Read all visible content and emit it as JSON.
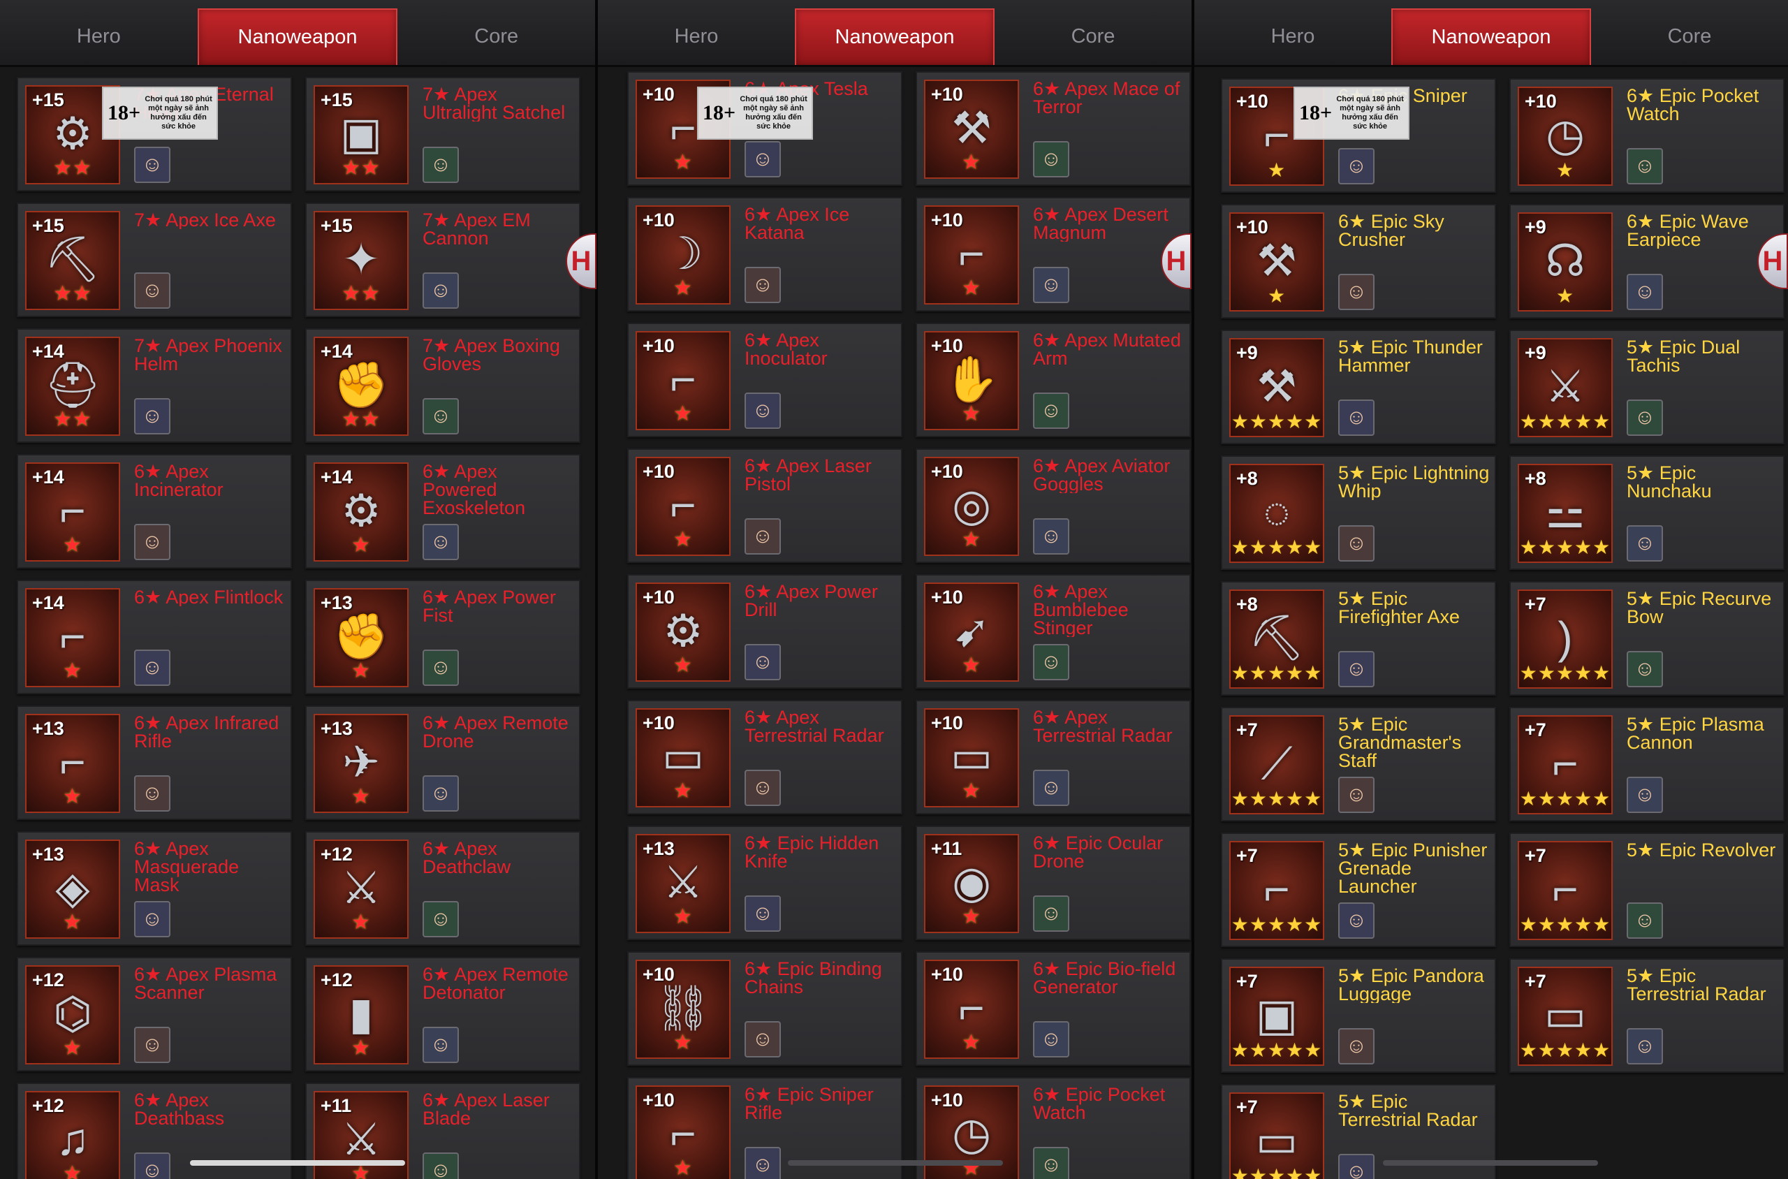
{
  "panels": [
    {
      "tabs": [
        {
          "label": "Hero",
          "active": false
        },
        {
          "label": "Nanoweapon",
          "active": true
        },
        {
          "label": "Core",
          "active": false
        }
      ],
      "items": [
        {
          "level": "+15",
          "stars": "★★",
          "name": "7★ Apex Eternal Heart",
          "icon": "heart-reactor-icon",
          "glyph": "⚙",
          "avatar": "☺"
        },
        {
          "level": "+15",
          "stars": "★★",
          "name": "7★ Apex Ultralight Satchel",
          "icon": "satchel-icon",
          "glyph": "▣",
          "avatar": "☺"
        },
        {
          "level": "+15",
          "stars": "★★",
          "name": "7★ Apex Ice Axe",
          "icon": "axe-icon",
          "glyph": "⛏",
          "avatar": "☺"
        },
        {
          "level": "+15",
          "stars": "★★",
          "name": "7★ Apex EM Cannon",
          "icon": "cannon-icon",
          "glyph": "✦",
          "avatar": "☺"
        },
        {
          "level": "+14",
          "stars": "★★",
          "name": "7★ Apex Phoenix Helm",
          "icon": "helmet-icon",
          "glyph": "⛑",
          "avatar": "☺"
        },
        {
          "level": "+14",
          "stars": "★★",
          "name": "7★ Apex Boxing Gloves",
          "icon": "glove-icon",
          "glyph": "✊",
          "avatar": "☺"
        },
        {
          "level": "+14",
          "stars": "★",
          "name": "6★ Apex Incinerator",
          "icon": "flamethrower-icon",
          "glyph": "⌐",
          "avatar": "☺"
        },
        {
          "level": "+14",
          "stars": "★",
          "name": "6★ Apex Powered Exoskeleton",
          "icon": "exoskeleton-icon",
          "glyph": "⚙",
          "avatar": "☺"
        },
        {
          "level": "+14",
          "stars": "★",
          "name": "6★ Apex Flintlock",
          "icon": "pistol-icon",
          "glyph": "⌐",
          "avatar": "☺"
        },
        {
          "level": "+13",
          "stars": "★",
          "name": "6★ Apex Power Fist",
          "icon": "fist-icon",
          "glyph": "✊",
          "avatar": "☺"
        },
        {
          "level": "+13",
          "stars": "★",
          "name": "6★ Apex Infrared Rifle",
          "icon": "rifle-icon",
          "glyph": "⌐",
          "avatar": "☺"
        },
        {
          "level": "+13",
          "stars": "★",
          "name": "6★ Apex Remote Drone",
          "icon": "drone-icon",
          "glyph": "✈",
          "avatar": "☺"
        },
        {
          "level": "+13",
          "stars": "★",
          "name": "6★ Apex Masquerade Mask",
          "icon": "mask-icon",
          "glyph": "◈",
          "avatar": "☺"
        },
        {
          "level": "+12",
          "stars": "★",
          "name": "6★ Apex Deathclaw",
          "icon": "claw-icon",
          "glyph": "⚔",
          "avatar": "☺"
        },
        {
          "level": "+12",
          "stars": "★",
          "name": "6★ Apex Plasma Scanner",
          "icon": "scanner-icon",
          "glyph": "⌬",
          "avatar": "☺"
        },
        {
          "level": "+12",
          "stars": "★",
          "name": "6★ Apex Remote Detonator",
          "icon": "detonator-icon",
          "glyph": "▮",
          "avatar": "☺"
        },
        {
          "level": "+12",
          "stars": "★",
          "name": "6★ Apex Deathbass",
          "icon": "guitar-icon",
          "glyph": "♫",
          "avatar": "☺"
        },
        {
          "level": "+11",
          "stars": "★",
          "name": "6★ Apex Laser Blade",
          "icon": "blade-icon",
          "glyph": "⚔",
          "avatar": "☺"
        }
      ]
    },
    {
      "tabs": [
        {
          "label": "Hero",
          "active": false
        },
        {
          "label": "Nanoweapon",
          "active": true
        },
        {
          "label": "Core",
          "active": false
        }
      ],
      "items": [
        {
          "level": "+10",
          "stars": "★",
          "name": "6★ Apex Tesla",
          "icon": "tesla-gun-icon",
          "glyph": "⌐",
          "avatar": "☺"
        },
        {
          "level": "+10",
          "stars": "★",
          "name": "6★ Apex Mace of Terror",
          "icon": "mace-icon",
          "glyph": "⚒",
          "avatar": "☺"
        },
        {
          "level": "+10",
          "stars": "★",
          "name": "6★ Apex Ice Katana",
          "icon": "katana-icon",
          "glyph": "☽",
          "avatar": "☺"
        },
        {
          "level": "+10",
          "stars": "★",
          "name": "6★ Apex Desert Magnum",
          "icon": "magnum-icon",
          "glyph": "⌐",
          "avatar": "☺"
        },
        {
          "level": "+10",
          "stars": "★",
          "name": "6★ Apex Inoculator",
          "icon": "syringe-gun-icon",
          "glyph": "⌐",
          "avatar": "☺"
        },
        {
          "level": "+10",
          "stars": "★",
          "name": "6★ Apex Mutated Arm",
          "icon": "mutated-arm-icon",
          "glyph": "✋",
          "avatar": "☺"
        },
        {
          "level": "+10",
          "stars": "★",
          "name": "6★ Apex Laser Pistol",
          "icon": "laser-pistol-icon",
          "glyph": "⌐",
          "avatar": "☺"
        },
        {
          "level": "+10",
          "stars": "★",
          "name": "6★ Apex Aviator Goggles",
          "icon": "goggles-icon",
          "glyph": "◎",
          "avatar": "☺"
        },
        {
          "level": "+10",
          "stars": "★",
          "name": "6★ Apex Power Drill",
          "icon": "drill-icon",
          "glyph": "⚙",
          "avatar": "☺"
        },
        {
          "level": "+10",
          "stars": "★",
          "name": "6★ Apex Bumblebee Stinger",
          "icon": "stinger-icon",
          "glyph": "➹",
          "avatar": "☺"
        },
        {
          "level": "+10",
          "stars": "★",
          "name": "6★ Apex Terrestrial Radar",
          "icon": "radar-icon",
          "glyph": "▭",
          "avatar": "☺"
        },
        {
          "level": "+10",
          "stars": "★",
          "name": "6★ Apex Terrestrial Radar",
          "icon": "radar-icon",
          "glyph": "▭",
          "avatar": "☺"
        },
        {
          "level": "+13",
          "stars": "★",
          "name": "6★ Epic Hidden Knife",
          "icon": "knife-icon",
          "glyph": "⚔",
          "avatar": "☺"
        },
        {
          "level": "+11",
          "stars": "★",
          "name": "6★ Epic Ocular Drone",
          "icon": "ocular-drone-icon",
          "glyph": "◉",
          "avatar": "☺"
        },
        {
          "level": "+10",
          "stars": "★",
          "name": "6★ Epic Binding Chains",
          "icon": "chains-icon",
          "glyph": "⛓",
          "avatar": "☺"
        },
        {
          "level": "+10",
          "stars": "★",
          "name": "6★ Epic Bio-field Generator",
          "icon": "generator-icon",
          "glyph": "⌐",
          "avatar": "☺"
        },
        {
          "level": "+10",
          "stars": "★",
          "name": "6★ Epic Sniper Rifle",
          "icon": "sniper-icon",
          "glyph": "⌐",
          "avatar": "☺"
        },
        {
          "level": "+10",
          "stars": "★",
          "name": "6★ Epic Pocket Watch",
          "icon": "watch-icon",
          "glyph": "◷",
          "avatar": "☺"
        }
      ]
    },
    {
      "tabs": [
        {
          "label": "Hero",
          "active": false
        },
        {
          "label": "Nanoweapon",
          "active": true
        },
        {
          "label": "Core",
          "active": false
        }
      ],
      "items": [
        {
          "level": "+10",
          "stars": "★",
          "name": "6★ Epic Sniper",
          "icon": "sniper-icon",
          "glyph": "⌐",
          "avatar": "☺",
          "tier": "gold"
        },
        {
          "level": "+10",
          "stars": "★",
          "name": "6★ Epic Pocket Watch",
          "icon": "watch-icon",
          "glyph": "◷",
          "avatar": "☺",
          "tier": "gold"
        },
        {
          "level": "+10",
          "stars": "★",
          "name": "6★ Epic Sky Crusher",
          "icon": "hammer-icon",
          "glyph": "⚒",
          "avatar": "☺",
          "tier": "gold"
        },
        {
          "level": "+9",
          "stars": "★",
          "name": "6★ Epic Wave Earpiece",
          "icon": "headset-icon",
          "glyph": "☊",
          "avatar": "☺",
          "tier": "gold"
        },
        {
          "level": "+9",
          "stars": "★★★★★",
          "name": "5★ Epic Thunder Hammer",
          "icon": "thunder-hammer-icon",
          "glyph": "⚒",
          "avatar": "☺",
          "tier": "gold"
        },
        {
          "level": "+9",
          "stars": "★★★★★",
          "name": "5★ Epic Dual Tachis",
          "icon": "swords-icon",
          "glyph": "⚔",
          "avatar": "☺",
          "tier": "gold"
        },
        {
          "level": "+8",
          "stars": "★★★★★",
          "name": "5★ Epic Lightning Whip",
          "icon": "whip-icon",
          "glyph": "◌",
          "avatar": "☺",
          "tier": "gold"
        },
        {
          "level": "+8",
          "stars": "★★★★★",
          "name": "5★ Epic Nunchaku",
          "icon": "nunchaku-icon",
          "glyph": "⚍",
          "avatar": "☺",
          "tier": "gold"
        },
        {
          "level": "+8",
          "stars": "★★★★★",
          "name": "5★ Epic Firefighter Axe",
          "icon": "fire-axe-icon",
          "glyph": "⛏",
          "avatar": "☺",
          "tier": "gold"
        },
        {
          "level": "+7",
          "stars": "★★★★★",
          "name": "5★ Epic Recurve Bow",
          "icon": "bow-icon",
          "glyph": ")",
          "avatar": "☺",
          "tier": "gold"
        },
        {
          "level": "+7",
          "stars": "★★★★★",
          "name": "5★ Epic Grandmaster's Staff",
          "icon": "staff-icon",
          "glyph": "⟋",
          "avatar": "☺",
          "tier": "gold"
        },
        {
          "level": "+7",
          "stars": "★★★★★",
          "name": "5★ Epic Plasma Cannon",
          "icon": "plasma-cannon-icon",
          "glyph": "⌐",
          "avatar": "☺",
          "tier": "gold"
        },
        {
          "level": "+7",
          "stars": "★★★★★",
          "name": "5★ Epic Punisher Grenade Launcher",
          "icon": "grenade-launcher-icon",
          "glyph": "⌐",
          "avatar": "☺",
          "tier": "gold"
        },
        {
          "level": "+7",
          "stars": "★★★★★",
          "name": "5★ Epic Revolver",
          "icon": "revolver-icon",
          "glyph": "⌐",
          "avatar": "☺",
          "tier": "gold"
        },
        {
          "level": "+7",
          "stars": "★★★★★",
          "name": "5★ Epic Pandora Luggage",
          "icon": "luggage-icon",
          "glyph": "▣",
          "avatar": "☺",
          "tier": "gold"
        },
        {
          "level": "+7",
          "stars": "★★★★★",
          "name": "5★ Epic Terrestrial Radar",
          "icon": "radar-icon",
          "glyph": "▭",
          "avatar": "☺",
          "tier": "gold"
        },
        {
          "level": "+7",
          "stars": "★★★★★",
          "name": "5★ Epic Terrestrial Radar",
          "icon": "radar-icon",
          "glyph": "▭",
          "avatar": "☺",
          "tier": "gold"
        }
      ]
    }
  ],
  "age_rating": {
    "age": "18+",
    "warning": "Chơi quá 180 phút một ngày sẽ ảnh hưởng xấu đến sức khỏe"
  },
  "side_badge": {
    "label": "H"
  },
  "colors": {
    "accent": "#c4262a",
    "apex_name": "#e8202a",
    "epic_name": "#ffd541",
    "background": "#181819"
  }
}
